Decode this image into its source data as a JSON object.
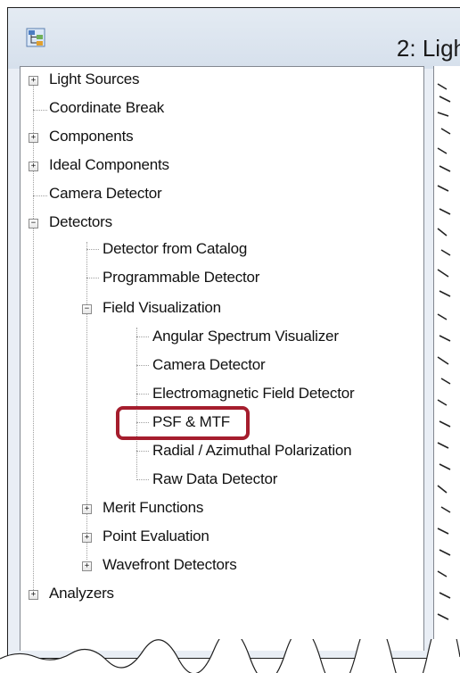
{
  "window": {
    "title": "2: Ligh"
  },
  "icons": {
    "app": "network-tree-icon",
    "expand": "plus-icon",
    "collapse": "minus-icon"
  },
  "colors": {
    "highlight": "#a51d2d"
  },
  "tree": {
    "light_sources": "Light Sources",
    "coordinate_break": "Coordinate Break",
    "components": "Components",
    "ideal_components": "Ideal Components",
    "camera_detector": "Camera Detector",
    "detectors": "Detectors",
    "detector_from_catalog": "Detector from Catalog",
    "programmable_detector": "Programmable Detector",
    "field_visualization": "Field Visualization",
    "angular_spectrum_visualizer": "Angular Spectrum Visualizer",
    "fv_camera_detector": "Camera Detector",
    "electromagnetic_field_detector": "Electromagnetic Field Detector",
    "psf_mtf": "PSF & MTF",
    "radial_azimuthal": "Radial / Azimuthal Polarization",
    "raw_data_detector": "Raw Data Detector",
    "merit_functions": "Merit Functions",
    "point_evaluation": "Point Evaluation",
    "wavefront_detectors": "Wavefront Detectors",
    "analyzers": "Analyzers"
  },
  "expanders": {
    "plus": "+",
    "minus": "−"
  }
}
